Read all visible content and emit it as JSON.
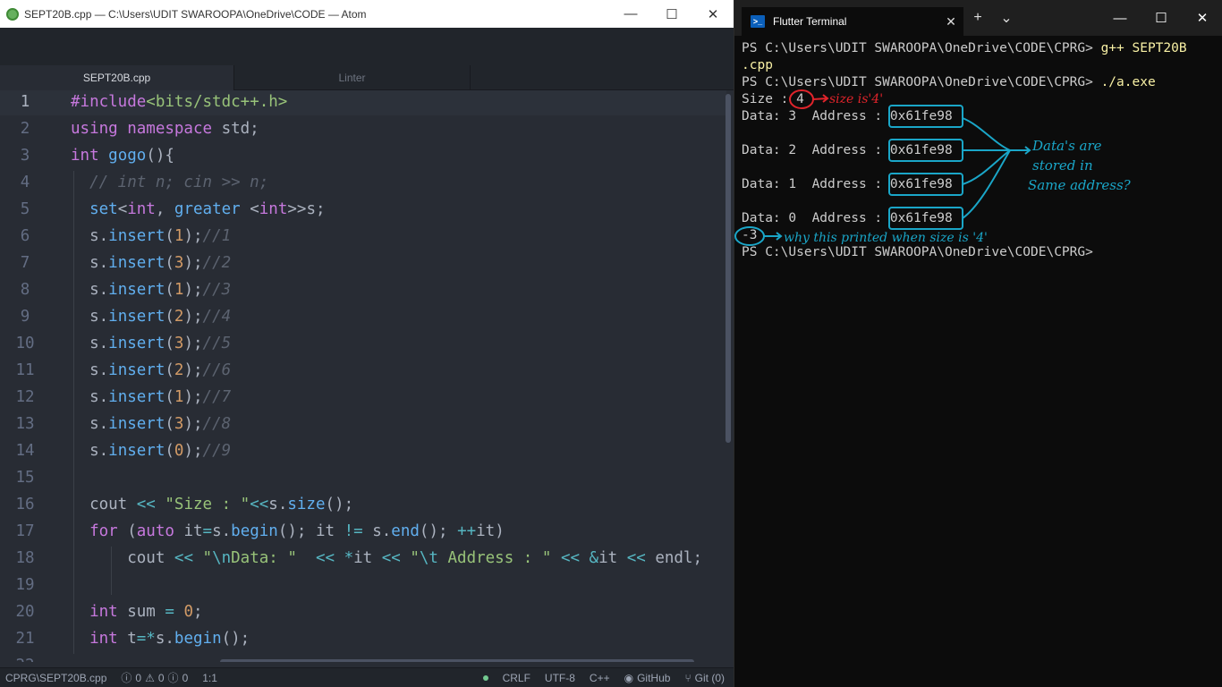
{
  "atom": {
    "title": "SEPT20B.cpp — C:\\Users\\UDIT SWAROOPA\\OneDrive\\CODE — Atom",
    "win_min": "—",
    "win_max": "☐",
    "win_close": "✕",
    "tabs": [
      {
        "label": "SEPT20B.cpp"
      },
      {
        "label": "Linter"
      }
    ],
    "code_lines": [
      {
        "num": "1",
        "tokens": [
          {
            "t": "#include",
            "c": "kw"
          },
          {
            "t": "<bits/stdc++.h>",
            "c": "str"
          }
        ]
      },
      {
        "num": "2",
        "tokens": [
          {
            "t": "using ",
            "c": "kw"
          },
          {
            "t": "namespace ",
            "c": "kw"
          },
          {
            "t": "std;",
            "c": "tx"
          }
        ]
      },
      {
        "num": "3",
        "tokens": [
          {
            "t": "int ",
            "c": "ty"
          },
          {
            "t": "gogo",
            "c": "fn"
          },
          {
            "t": "(){",
            "c": "tx"
          }
        ]
      },
      {
        "num": "4",
        "tokens": [
          {
            "t": "  // int n; cin >> n;",
            "c": "cm"
          }
        ]
      },
      {
        "num": "5",
        "tokens": [
          {
            "t": "  set",
            "c": "fn"
          },
          {
            "t": "<",
            "c": "tx"
          },
          {
            "t": "int",
            "c": "ty"
          },
          {
            "t": ", ",
            "c": "tx"
          },
          {
            "t": "greater ",
            "c": "fn"
          },
          {
            "t": "<",
            "c": "tx"
          },
          {
            "t": "int",
            "c": "ty"
          },
          {
            "t": ">>s;",
            "c": "tx"
          }
        ]
      },
      {
        "num": "6",
        "tokens": [
          {
            "t": "  s.",
            "c": "tx"
          },
          {
            "t": "insert",
            "c": "fn"
          },
          {
            "t": "(",
            "c": "tx"
          },
          {
            "t": "1",
            "c": "num"
          },
          {
            "t": ");",
            "c": "tx"
          },
          {
            "t": "//1",
            "c": "cm"
          }
        ]
      },
      {
        "num": "7",
        "tokens": [
          {
            "t": "  s.",
            "c": "tx"
          },
          {
            "t": "insert",
            "c": "fn"
          },
          {
            "t": "(",
            "c": "tx"
          },
          {
            "t": "3",
            "c": "num"
          },
          {
            "t": ");",
            "c": "tx"
          },
          {
            "t": "//2",
            "c": "cm"
          }
        ]
      },
      {
        "num": "8",
        "tokens": [
          {
            "t": "  s.",
            "c": "tx"
          },
          {
            "t": "insert",
            "c": "fn"
          },
          {
            "t": "(",
            "c": "tx"
          },
          {
            "t": "1",
            "c": "num"
          },
          {
            "t": ");",
            "c": "tx"
          },
          {
            "t": "//3",
            "c": "cm"
          }
        ]
      },
      {
        "num": "9",
        "tokens": [
          {
            "t": "  s.",
            "c": "tx"
          },
          {
            "t": "insert",
            "c": "fn"
          },
          {
            "t": "(",
            "c": "tx"
          },
          {
            "t": "2",
            "c": "num"
          },
          {
            "t": ");",
            "c": "tx"
          },
          {
            "t": "//4",
            "c": "cm"
          }
        ]
      },
      {
        "num": "10",
        "tokens": [
          {
            "t": "  s.",
            "c": "tx"
          },
          {
            "t": "insert",
            "c": "fn"
          },
          {
            "t": "(",
            "c": "tx"
          },
          {
            "t": "3",
            "c": "num"
          },
          {
            "t": ");",
            "c": "tx"
          },
          {
            "t": "//5",
            "c": "cm"
          }
        ]
      },
      {
        "num": "11",
        "tokens": [
          {
            "t": "  s.",
            "c": "tx"
          },
          {
            "t": "insert",
            "c": "fn"
          },
          {
            "t": "(",
            "c": "tx"
          },
          {
            "t": "2",
            "c": "num"
          },
          {
            "t": ");",
            "c": "tx"
          },
          {
            "t": "//6",
            "c": "cm"
          }
        ]
      },
      {
        "num": "12",
        "tokens": [
          {
            "t": "  s.",
            "c": "tx"
          },
          {
            "t": "insert",
            "c": "fn"
          },
          {
            "t": "(",
            "c": "tx"
          },
          {
            "t": "1",
            "c": "num"
          },
          {
            "t": ");",
            "c": "tx"
          },
          {
            "t": "//7",
            "c": "cm"
          }
        ]
      },
      {
        "num": "13",
        "tokens": [
          {
            "t": "  s.",
            "c": "tx"
          },
          {
            "t": "insert",
            "c": "fn"
          },
          {
            "t": "(",
            "c": "tx"
          },
          {
            "t": "3",
            "c": "num"
          },
          {
            "t": ");",
            "c": "tx"
          },
          {
            "t": "//8",
            "c": "cm"
          }
        ]
      },
      {
        "num": "14",
        "tokens": [
          {
            "t": "  s.",
            "c": "tx"
          },
          {
            "t": "insert",
            "c": "fn"
          },
          {
            "t": "(",
            "c": "tx"
          },
          {
            "t": "0",
            "c": "num"
          },
          {
            "t": ");",
            "c": "tx"
          },
          {
            "t": "//9",
            "c": "cm"
          }
        ]
      },
      {
        "num": "15",
        "tokens": []
      },
      {
        "num": "16",
        "tokens": [
          {
            "t": "  cout ",
            "c": "tx"
          },
          {
            "t": "<< ",
            "c": "op"
          },
          {
            "t": "\"Size : \"",
            "c": "str"
          },
          {
            "t": "<<",
            "c": "op"
          },
          {
            "t": "s.",
            "c": "tx"
          },
          {
            "t": "size",
            "c": "fn"
          },
          {
            "t": "();",
            "c": "tx"
          }
        ]
      },
      {
        "num": "17",
        "tokens": [
          {
            "t": "  for ",
            "c": "kw"
          },
          {
            "t": "(",
            "c": "tx"
          },
          {
            "t": "auto ",
            "c": "ty"
          },
          {
            "t": "it",
            "c": "tx"
          },
          {
            "t": "=",
            "c": "op"
          },
          {
            "t": "s.",
            "c": "tx"
          },
          {
            "t": "begin",
            "c": "fn"
          },
          {
            "t": "(); it ",
            "c": "tx"
          },
          {
            "t": "!= ",
            "c": "op"
          },
          {
            "t": "s.",
            "c": "tx"
          },
          {
            "t": "end",
            "c": "fn"
          },
          {
            "t": "(); ",
            "c": "tx"
          },
          {
            "t": "++",
            "c": "op"
          },
          {
            "t": "it)",
            "c": "tx"
          }
        ]
      },
      {
        "num": "18",
        "tokens": [
          {
            "t": "      cout ",
            "c": "tx"
          },
          {
            "t": "<< ",
            "c": "op"
          },
          {
            "t": "\"",
            "c": "str"
          },
          {
            "t": "\\n",
            "c": "es"
          },
          {
            "t": "Data: \"  ",
            "c": "str"
          },
          {
            "t": "<< ",
            "c": "op"
          },
          {
            "t": "*",
            "c": "op"
          },
          {
            "t": "it ",
            "c": "tx"
          },
          {
            "t": "<< ",
            "c": "op"
          },
          {
            "t": "\"",
            "c": "str"
          },
          {
            "t": "\\t",
            "c": "es"
          },
          {
            "t": " Address : \" ",
            "c": "str"
          },
          {
            "t": "<< ",
            "c": "op"
          },
          {
            "t": "&",
            "c": "op"
          },
          {
            "t": "it ",
            "c": "tx"
          },
          {
            "t": "<< ",
            "c": "op"
          },
          {
            "t": "endl;",
            "c": "tx"
          }
        ]
      },
      {
        "num": "19",
        "tokens": []
      },
      {
        "num": "20",
        "tokens": [
          {
            "t": "  int ",
            "c": "ty"
          },
          {
            "t": "sum ",
            "c": "tx"
          },
          {
            "t": "= ",
            "c": "op"
          },
          {
            "t": "0",
            "c": "num"
          },
          {
            "t": ";",
            "c": "tx"
          }
        ]
      },
      {
        "num": "21",
        "tokens": [
          {
            "t": "  int ",
            "c": "ty"
          },
          {
            "t": "t",
            "c": "tx"
          },
          {
            "t": "=*",
            "c": "op"
          },
          {
            "t": "s.",
            "c": "tx"
          },
          {
            "t": "begin",
            "c": "fn"
          },
          {
            "t": "();",
            "c": "tx"
          }
        ]
      },
      {
        "num": "22",
        "tokens": []
      }
    ],
    "status": {
      "path": "CPRG\\SEPT20B.cpp",
      "errors": "0",
      "warnings": "0",
      "infos": "0",
      "cursor": "1:1",
      "line_ending": "CRLF",
      "encoding": "UTF-8",
      "grammar": "C++",
      "github": "GitHub",
      "git": "Git (0)"
    }
  },
  "terminal": {
    "tab_label": "Flutter Terminal",
    "tab_icon": "powershell-icon",
    "close_glyph": "✕",
    "new_tab_glyph": "+",
    "dropdown_glyph": "⌄",
    "win_min": "—",
    "win_max": "☐",
    "win_close": "✕",
    "lines": [
      {
        "prompt": "PS C:\\Users\\UDIT SWAROOPA\\OneDrive\\CODE\\CPRG> ",
        "cmd": "g++ SEPT20B"
      },
      {
        "prompt": "",
        "cmd": ".cpp"
      },
      {
        "prompt": "PS C:\\Users\\UDIT SWAROOPA\\OneDrive\\CODE\\CPRG> ",
        "cmd": "./a.exe"
      },
      {
        "prompt": "Size : 4",
        "cmd": ""
      },
      {
        "prompt": "Data: 3  Address : 0x61fe98",
        "cmd": ""
      },
      {
        "prompt": "",
        "cmd": ""
      },
      {
        "prompt": "Data: 2  Address : 0x61fe98",
        "cmd": ""
      },
      {
        "prompt": "",
        "cmd": ""
      },
      {
        "prompt": "Data: 1  Address : 0x61fe98",
        "cmd": ""
      },
      {
        "prompt": "",
        "cmd": ""
      },
      {
        "prompt": "Data: 0  Address : 0x61fe98",
        "cmd": ""
      },
      {
        "prompt": "-3",
        "cmd": ""
      },
      {
        "prompt": "PS C:\\Users\\UDIT SWAROOPA\\OneDrive\\CODE\\CPRG>",
        "cmd": ""
      }
    ],
    "annotations": {
      "size_note": "size is'4'",
      "address_note_1": "Data's are",
      "address_note_2": "stored in",
      "address_note_3": "Same address?",
      "minus3_note": "why this printed  when size is '4'"
    }
  },
  "colors": {
    "editor_bg": "#282c34",
    "terminal_bg": "#0c0c0c",
    "annotation_red": "#e0242b",
    "annotation_cyan": "#1aa6c8"
  }
}
